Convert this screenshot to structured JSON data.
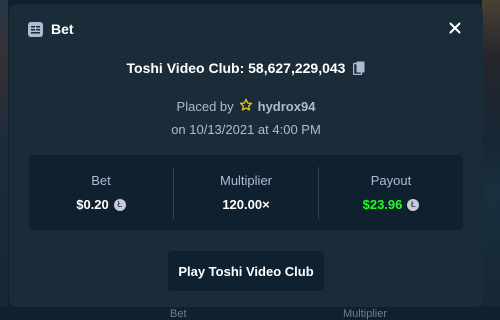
{
  "background": {
    "bottom_labels": [
      "Bet",
      "Multiplier"
    ]
  },
  "modal": {
    "title": "Bet",
    "title_icon": "bet-slip-icon",
    "close_icon": "close-icon",
    "game_title": "Toshi Video Club: 58,627,229,043",
    "copy_icon": "copy-icon",
    "placed_by_label": "Placed by",
    "user_icon": "star-outline-icon",
    "username": "hydrox94",
    "placed_at": "on 10/13/2021 at 4:00 PM",
    "stats": {
      "bet": {
        "label": "Bet",
        "value": "$0.20",
        "currency_icon": "litecoin-icon"
      },
      "multiplier": {
        "label": "Multiplier",
        "value": "120.00×"
      },
      "payout": {
        "label": "Payout",
        "value": "$23.96",
        "currency_icon": "litecoin-icon"
      }
    },
    "play_button": "Play Toshi Video Club"
  },
  "colors": {
    "modal_bg": "#1a2c38",
    "page_bg": "#0f212e",
    "muted_text": "#b1bad3",
    "payout_green": "#1fff20",
    "star": "#f5c518"
  }
}
